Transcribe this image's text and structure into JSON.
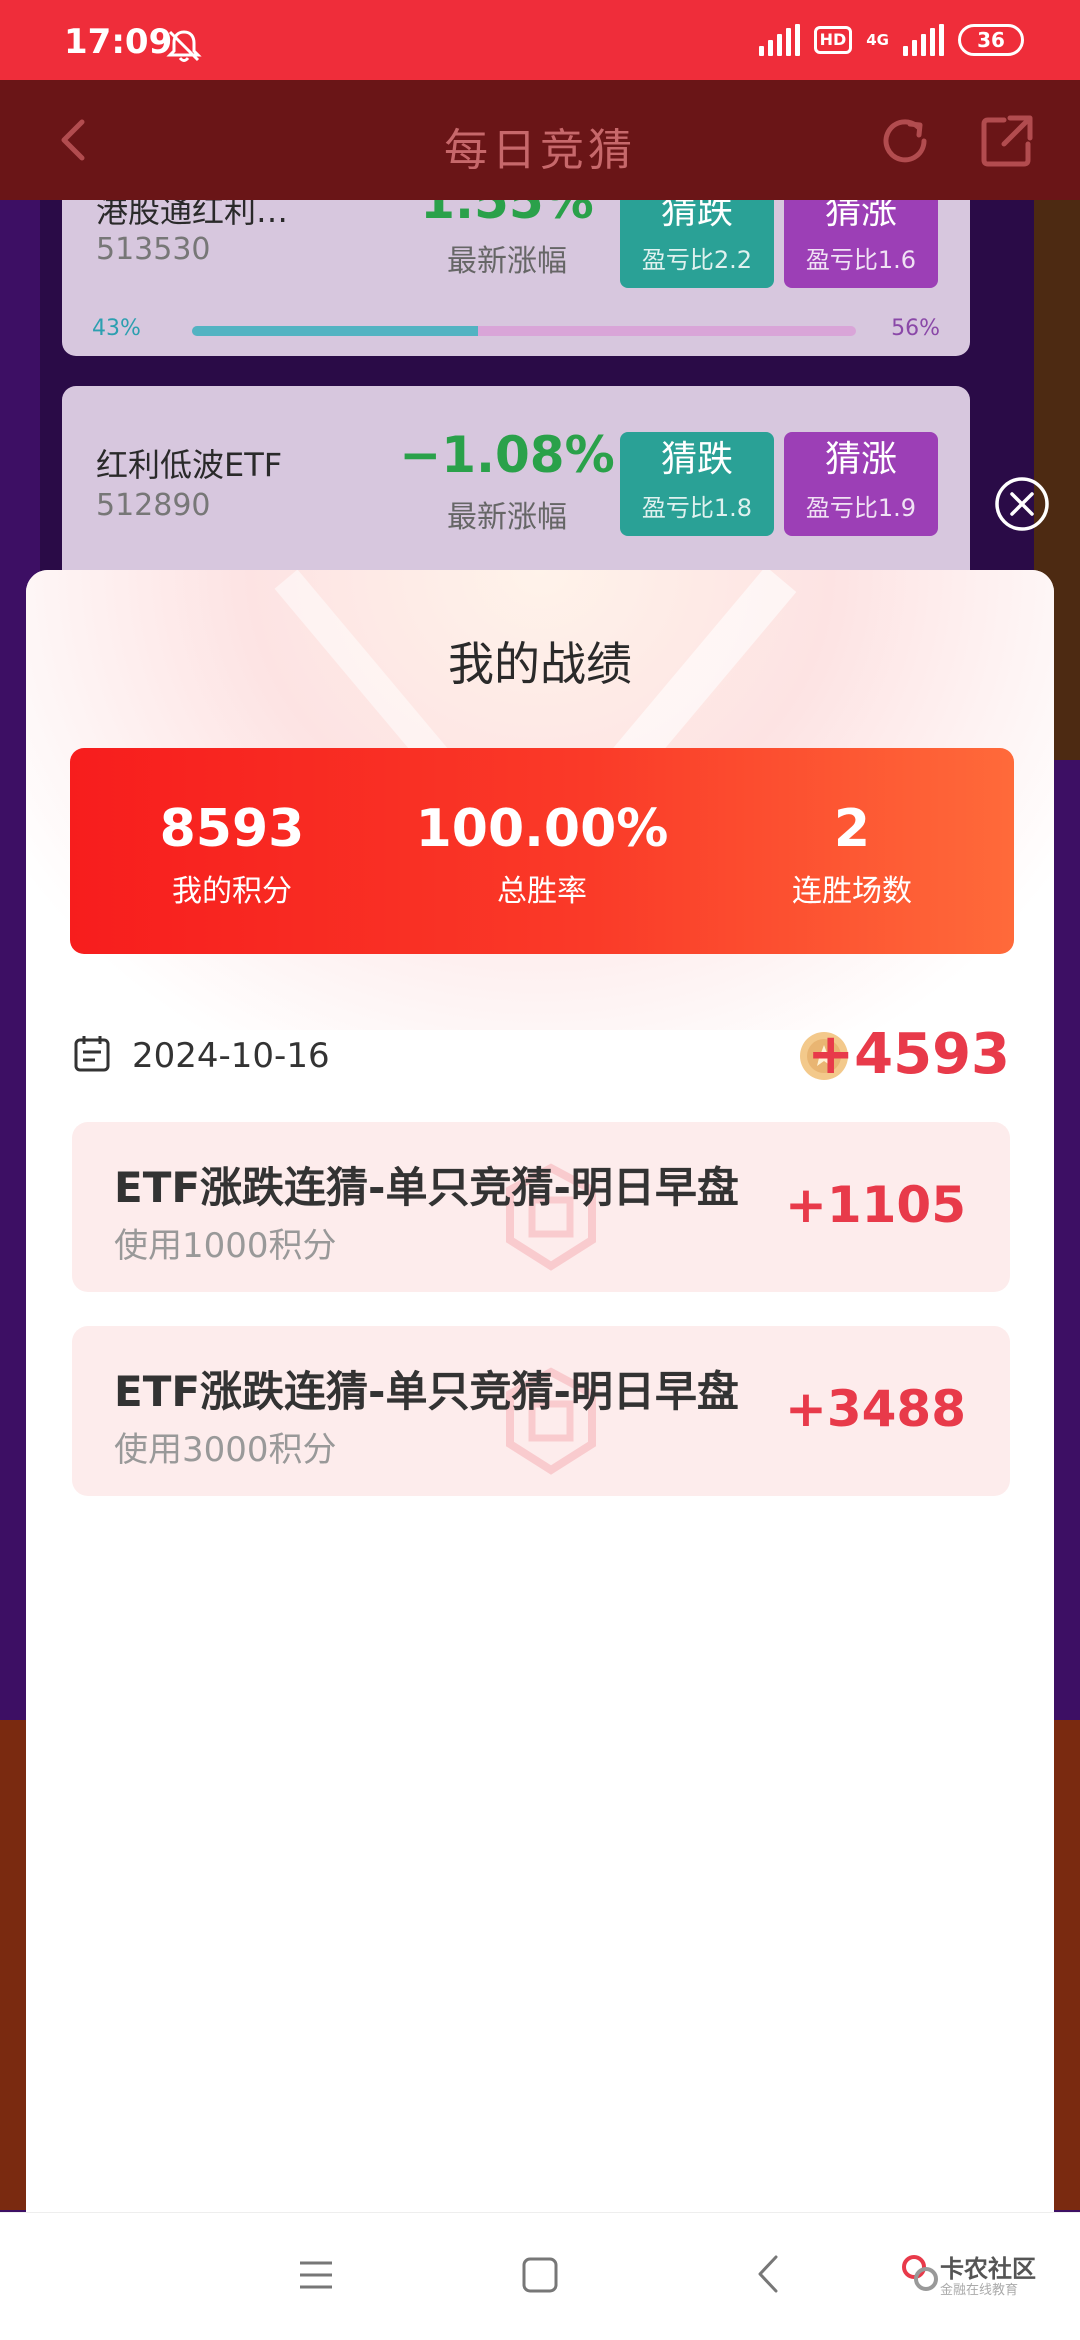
{
  "status_bar": {
    "time": "17:09",
    "hd": "HD",
    "network": "4G",
    "battery": "36"
  },
  "header": {
    "title": "每日竞猜"
  },
  "background_cards": [
    {
      "name": "港股通红利…",
      "code": "513530",
      "change": "1.55%",
      "change_label": "最新涨幅",
      "down_label": "猜跌",
      "down_ratio": "盈亏比2.2",
      "up_label": "猜涨",
      "up_ratio": "盈亏比1.6",
      "down_pct": "43%",
      "up_pct": "56%",
      "down_fraction": 0.43
    },
    {
      "name": "红利低波ETF",
      "code": "512890",
      "change": "−1.08%",
      "change_label": "最新涨幅",
      "down_label": "猜跌",
      "down_ratio": "盈亏比1.8",
      "up_label": "猜涨",
      "up_ratio": "盈亏比1.9"
    }
  ],
  "modal": {
    "title": "我的战绩",
    "stats": {
      "points_value": "8593",
      "points_label": "我的积分",
      "winrate_value": "100.00%",
      "winrate_label": "总胜率",
      "streak_value": "2",
      "streak_label": "连胜场数"
    },
    "date": "2024-10-16",
    "total_gain": "+4593",
    "records": [
      {
        "title": "ETF涨跌连猜-单只竞猜-明日早盘",
        "sub": "使用1000积分",
        "gain": "+1105"
      },
      {
        "title": "ETF涨跌连猜-单只竞猜-明日早盘",
        "sub": "使用3000积分",
        "gain": "+3488"
      }
    ]
  },
  "watermark": {
    "name": "卡农社区",
    "sub": "金融在线教育"
  },
  "colors": {
    "accent_red": "#e83a4a",
    "status_bar": "#ef2d3a",
    "guess_down": "#2aa196",
    "guess_up": "#9c3fb6"
  }
}
